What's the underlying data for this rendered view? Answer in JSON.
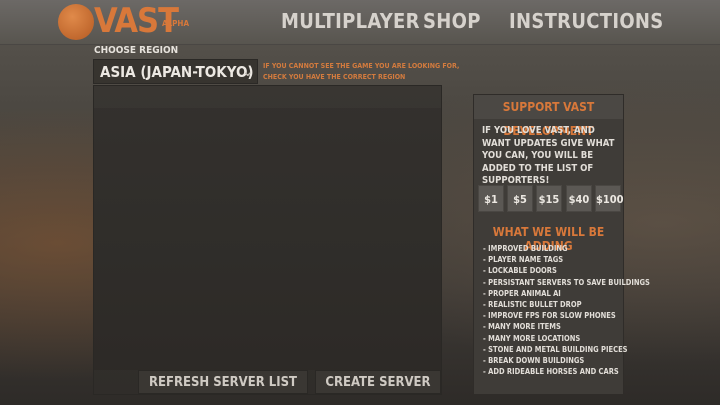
{
  "header": {
    "logo_text": "VAST",
    "logo_badge": "ALPHA",
    "nav": [
      "MULTIPLAYER",
      "SHOP",
      "INSTRUCTIONS"
    ]
  },
  "region": {
    "label": "CHOOSE REGION",
    "selected": "ASIA (JAPAN-TOKYO)",
    "hint_line1": "IF YOU CANNOT SEE THE GAME YOU ARE LOOKING FOR,",
    "hint_line2": "CHECK YOU HAVE THE CORRECT REGION"
  },
  "server_list": {
    "refresh_label": "REFRESH SERVER LIST",
    "create_label": "CREATE SERVER"
  },
  "support": {
    "title": "SUPPORT VAST DEVELOPMENT",
    "text": "IF YOU LOVE VAST, AND WANT UPDATES GIVE  WHAT YOU CAN, YOU WILL BE ADDED TO THE LIST OF SUPPORTERS!",
    "amounts": [
      "$1",
      "$5",
      "$15",
      "$40",
      "$100"
    ],
    "adding_title": "WHAT WE WILL BE ADDING",
    "adding_items": [
      "- IMPROVED BUILDING",
      "- PLAYER NAME TAGS",
      "- LOCKABLE DOORS",
      "- PERSISTANT SERVERS TO SAVE BUILDINGS",
      "- PROPER ANIMAL AI",
      "- REALISTIC BULLET DROP",
      "- IMPROVE FPS FOR SLOW PHONES",
      "- MANY MORE ITEMS",
      "- MANY MORE LOCATIONS",
      "- STONE AND METAL BUILDING PIECES",
      "- BREAK DOWN BUILDINGS",
      "- ADD RIDEABLE HORSES AND CARS"
    ]
  },
  "colors": {
    "accent": "#d8783a",
    "topbar": "#605d59",
    "panel": "#3f3c38"
  }
}
